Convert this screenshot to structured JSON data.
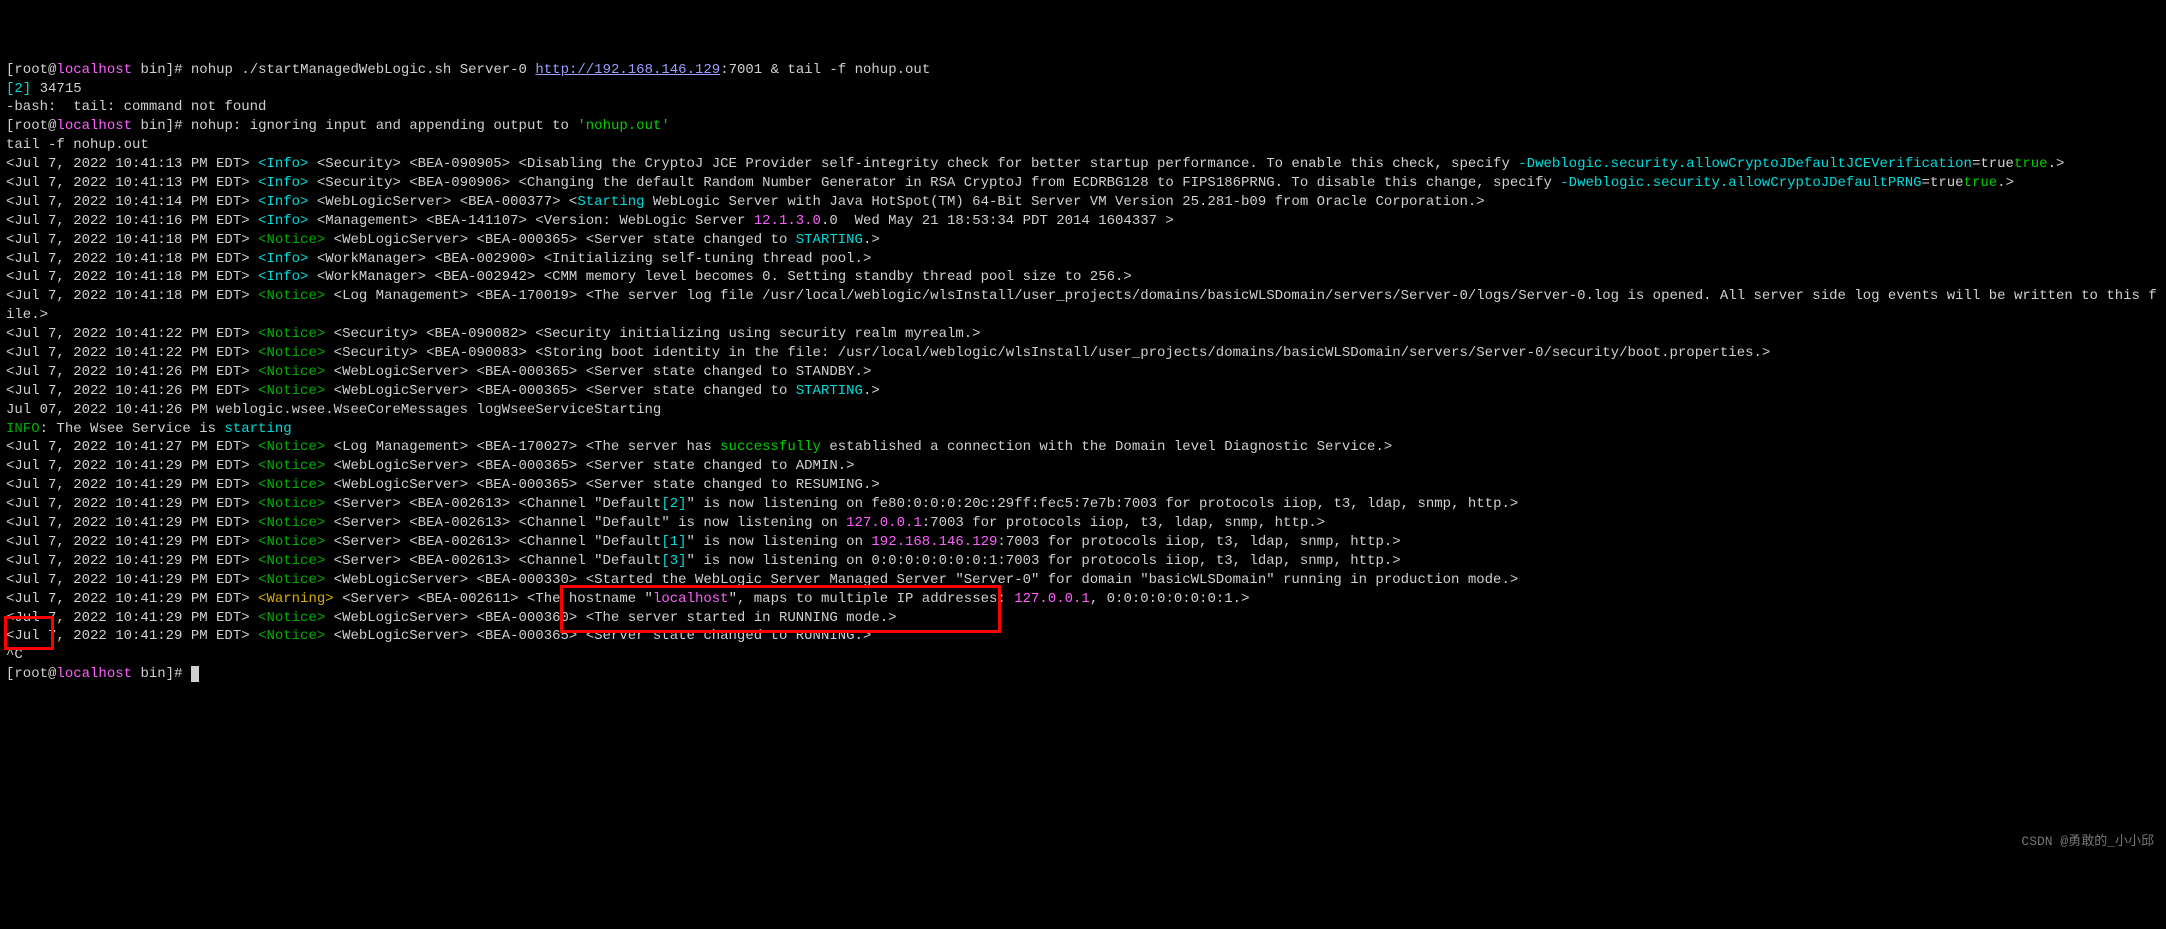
{
  "prompt_user": "root",
  "prompt_host": "localhost",
  "prompt_dir": "bin",
  "cmd_nohup": "nohup ./startManagedWebLogic.sh Server-0 ",
  "cmd_url": "http://192.168.146.129",
  "cmd_rest": ":7001 & tail -f nohup.out",
  "job_id": "[2]",
  "job_pid": " 34715",
  "bash_err": "-bash:  tail: command not found",
  "nohup_msg_pre": "nohup: ignoring input and appending output to ",
  "nohup_file": "'nohup.out'",
  "tail_cmd": "tail -f nohup.out",
  "line_sec1_ts": "<Jul 7, 2022 10:41:13 PM EDT> ",
  "info_tag": "<Info>",
  "notice_tag": "<Notice>",
  "warn_tag": "<Warning>",
  "sec1_a": " <Security> <BEA-090905> <Disabling the CryptoJ JCE Provider self-integrity check for better startup performance. To enable this check, specify ",
  "sec1_opt": "-Dweblogic.security.allowCryptoJDefaultJCEVerification",
  "eq_true": "=true",
  "sec2_ts": "<Jul 7, 2022 10:41:13 PM EDT> ",
  "sec2_a": " <Security> <BEA-090906> <Changing the default Random Number Generator in RSA CryptoJ from ECDRBG128 to FIPS186PRNG. To disable this change, specify ",
  "sec2_opt": "-Dweblogic.security.allowCryptoJDefaultPRNG",
  "wls1_ts": "<Jul 7, 2022 10:41:14 PM EDT> ",
  "wls1_a": " <WebLogicServer> <BEA-000377> <",
  "starting": "Starting",
  "wls1_b": " WebLogic Server with Java HotSpot(TM) 64-Bit Server VM Version 25.281-b09 from Oracle Corporation.>",
  "mgmt_ts": "<Jul 7, 2022 10:41:16 PM EDT> ",
  "mgmt_a": " <Management> <BEA-141107> <Version: WebLogic Server ",
  "wls_ver": "12.1.3.0",
  "mgmt_b": ".0  Wed May 21 18:53:34 PDT 2014 1604337 >",
  "st1_ts": "<Jul 7, 2022 10:41:18 PM EDT> ",
  "st1_a": " <WebLogicServer> <BEA-000365> <Server state changed to ",
  "st_starting": "STARTING",
  "wm1_ts": "<Jul 7, 2022 10:41:18 PM EDT> ",
  "wm1_a": " <WorkManager> <BEA-002900> <Initializing self-tuning thread pool.>",
  "wm2_ts": "<Jul 7, 2022 10:41:18 PM EDT> ",
  "wm2_a": " <WorkManager> <BEA-002942> <CMM memory level becomes 0. Setting standby thread pool size to 256.>",
  "log1_ts": "<Jul 7, 2022 10:41:18 PM EDT> ",
  "log1_a": " <Log Management> <BEA-170019> <The server log file /usr/local/weblogic/wlsInstall/user_projects/domains/basicWLSDomain/servers/Server-0/logs/Server-0.log is opened. All server side log events will be written to this file.>",
  "secr1_ts": "<Jul 7, 2022 10:41:22 PM EDT> ",
  "secr1_a": " <Security> <BEA-090082> <Security initializing using security realm myrealm.>",
  "secr2_ts": "<Jul 7, 2022 10:41:22 PM EDT> ",
  "secr2_a": " <Security> <BEA-090083> <Storing boot identity in the file: /usr/local/weblogic/wlsInstall/user_projects/domains/basicWLSDomain/servers/Server-0/security/boot.properties.>",
  "st2_ts": "<Jul 7, 2022 10:41:26 PM EDT> ",
  "st2_a": " <WebLogicServer> <BEA-000365> <Server state changed to STANDBY.>",
  "st3_ts": "<Jul 7, 2022 10:41:26 PM EDT> ",
  "st3_a": " <WebLogicServer> <BEA-000365> <Server state changed to ",
  "wsee_line": "Jul 07, 2022 10:41:26 PM weblogic.wsee.WseeCoreMessages logWseeServiceStarting",
  "info_label": "INFO",
  "wsee_msg_a": ": The Wsee Service is ",
  "wsee_starting": "starting",
  "log2_ts": "<Jul 7, 2022 10:41:27 PM EDT> ",
  "log2_a": " <Log Management> <BEA-170027> <The server has ",
  "success": "successfully",
  "log2_b": " established a connection with the Domain level Diagnostic Service.>",
  "st4_ts": "<Jul 7, 2022 10:41:29 PM EDT> ",
  "st4_a": " <WebLogicServer> <BEA-000365> <Server state changed to ADMIN.>",
  "st5_ts": "<Jul 7, 2022 10:41:29 PM EDT> ",
  "st5_a": " <WebLogicServer> <BEA-000365> <Server state changed to RESUMING.>",
  "ch1_ts": "<Jul 7, 2022 10:41:29 PM EDT> ",
  "ch1_a": " <Server> <BEA-002613> <Channel \"Default",
  "ch1_idx": "[2]",
  "ch1_b": "\" is now listening on fe80:0:0:0:20c:29ff:fec5:7e7b:7003 for protocols iiop, t3, ldap, snmp, http.>",
  "ch2_ts": "<Jul 7, 2022 10:41:29 PM EDT> ",
  "ch2_a": " <Server> <BEA-002613> <Channel \"Default\" is now listening on ",
  "ip_local": "127.0.0.1",
  "ch2_b": ":7003 for protocols iiop, t3, ldap, snmp, http.>",
  "ch3_ts": "<Jul 7, 2022 10:41:29 PM EDT> ",
  "ch3_a": " <Server> <BEA-002613> <Channel \"Default",
  "ch3_idx": "[1]",
  "ch3_b": "\" is now listening on ",
  "ip_lan": "192.168.146.129",
  "ch3_c": ":7003 for protocols iiop, t3, ldap, snmp, http.>",
  "ch4_ts": "<Jul 7, 2022 10:41:29 PM EDT> ",
  "ch4_a": " <Server> <BEA-002613> <Channel \"Default",
  "ch4_idx": "[3]",
  "ch4_b": "\" is now listening on 0:0:0:0:0:0:0:1:7003 for protocols iiop, t3, ldap, snmp, http.>",
  "start_ts": "<Jul 7, 2022 10:41:29 PM EDT> ",
  "start_a": " <WebLogicServer> <BEA-000330> <Started the WebLogic Server Managed Server \"Server-0\" for domain \"basicWLSDomain\" running in production mode.>",
  "warn_ts": "<Jul 7, 2022 10:41:29 PM EDT> ",
  "warn_a": " <Server> <BEA-002611> <The hostname \"",
  "warn_host": "localhost",
  "warn_b": "\", maps to multiple IP addresses: ",
  "warn_c": ", 0:0:0:0:0:0:0:1.>",
  "run1_ts": "<Jul 7, 2022 10:41:29 PM EDT> ",
  "run1_a": " <WebLogicServer> <BEA-000360> <The server started in RUNNING mode.>",
  "run2_ts": "<Jul 7, 2022 10:41:29 PM EDT> ",
  "run2_a": " <WebLogicServer> <BEA-000365> <Server state changed to RUNNING.>",
  "ctrl_c": "^C",
  "dot_gt": ".>",
  "watermark": "CSDN @勇敢的_小小邱"
}
